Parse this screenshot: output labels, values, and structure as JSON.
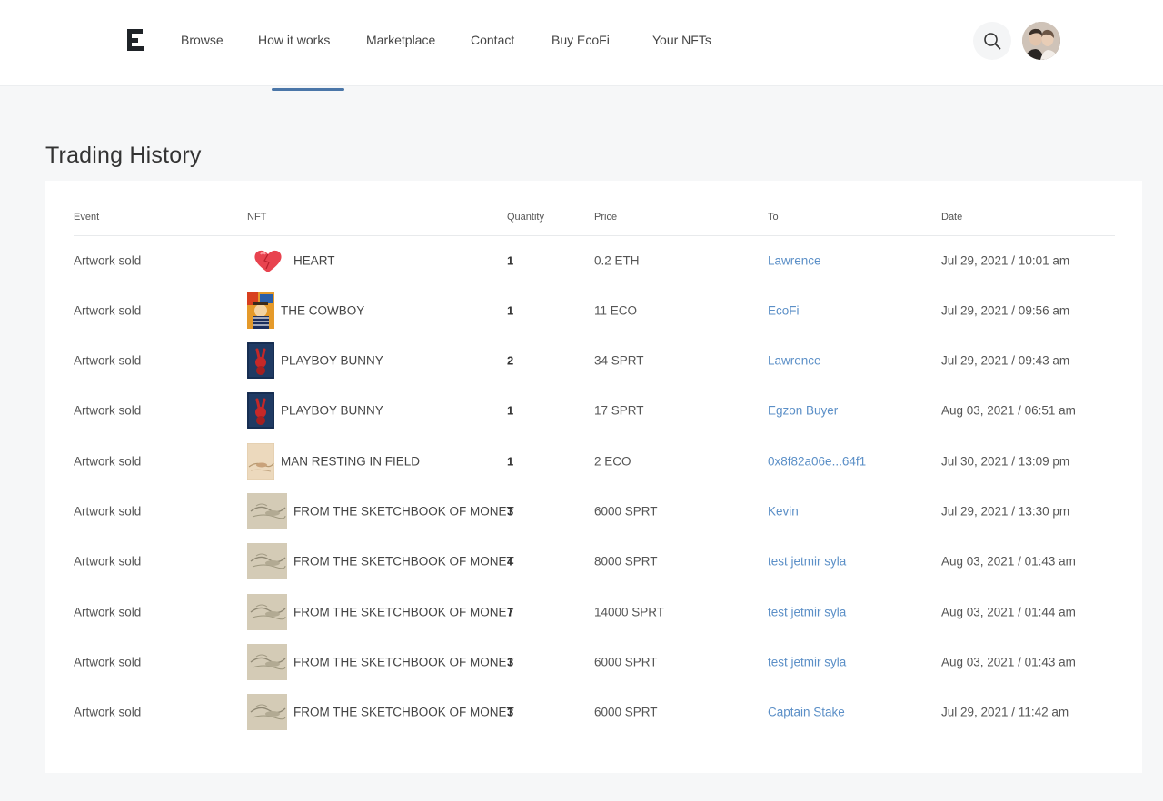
{
  "nav": {
    "items": [
      "Browse",
      "How it works",
      "Marketplace",
      "Contact",
      "Buy EcoFi",
      "Your NFTs"
    ]
  },
  "page": {
    "title": "Trading History"
  },
  "table": {
    "columns": [
      "Event",
      "NFT",
      "Quantity",
      "Price",
      "To",
      "Date"
    ],
    "rows": [
      {
        "event": "Artwork sold",
        "thumb": "heart",
        "nft": "HEART",
        "qty": "1",
        "price": "0.2 ETH",
        "to": "Lawrence",
        "date": "Jul 29, 2021 / 10:01 am"
      },
      {
        "event": "Artwork sold",
        "thumb": "cowboy",
        "nft": "THE COWBOY",
        "qty": "1",
        "price": "11 ECO",
        "to": "EcoFi",
        "date": "Jul 29, 2021 / 09:56 am"
      },
      {
        "event": "Artwork sold",
        "thumb": "bunny",
        "nft": "PLAYBOY BUNNY",
        "qty": "2",
        "price": "34 SPRT",
        "to": "Lawrence",
        "date": "Jul 29, 2021 / 09:43 am"
      },
      {
        "event": "Artwork sold",
        "thumb": "bunny",
        "nft": "PLAYBOY BUNNY",
        "qty": "1",
        "price": "17 SPRT",
        "to": "Egzon Buyer",
        "date": "Aug 03, 2021 / 06:51 am"
      },
      {
        "event": "Artwork sold",
        "thumb": "field",
        "nft": "MAN RESTING IN FIELD",
        "qty": "1",
        "price": "2 ECO",
        "to": "0x8f82a06e...64f1",
        "date": "Jul 30, 2021 / 13:09 pm"
      },
      {
        "event": "Artwork sold",
        "thumb": "monet",
        "nft": "FROM THE SKETCHBOOK OF MONET",
        "qty": "3",
        "price": "6000 SPRT",
        "to": "Kevin",
        "date": "Jul 29, 2021 / 13:30 pm"
      },
      {
        "event": "Artwork sold",
        "thumb": "monet",
        "nft": "FROM THE SKETCHBOOK OF MONET",
        "qty": "4",
        "price": "8000 SPRT",
        "to": "test jetmir syla",
        "date": "Aug 03, 2021 / 01:43 am"
      },
      {
        "event": "Artwork sold",
        "thumb": "monet",
        "nft": "FROM THE SKETCHBOOK OF MONET",
        "qty": "7",
        "price": "14000 SPRT",
        "to": "test jetmir syla",
        "date": "Aug 03, 2021 / 01:44 am"
      },
      {
        "event": "Artwork sold",
        "thumb": "monet",
        "nft": "FROM THE SKETCHBOOK OF MONET",
        "qty": "3",
        "price": "6000 SPRT",
        "to": "test jetmir syla",
        "date": "Aug 03, 2021 / 01:43 am"
      },
      {
        "event": "Artwork sold",
        "thumb": "monet",
        "nft": "FROM THE SKETCHBOOK OF MONET",
        "qty": "3",
        "price": "6000 SPRT",
        "to": "Captain Stake",
        "date": "Jul 29, 2021 / 11:42 am"
      }
    ]
  },
  "colors": {
    "link": "#5b8fc7",
    "accent": "#4a76a8",
    "background": "#f6f7f8"
  },
  "icons": {
    "logo": "ecofi-logo-icon",
    "search": "search-icon",
    "avatar": "avatar"
  }
}
